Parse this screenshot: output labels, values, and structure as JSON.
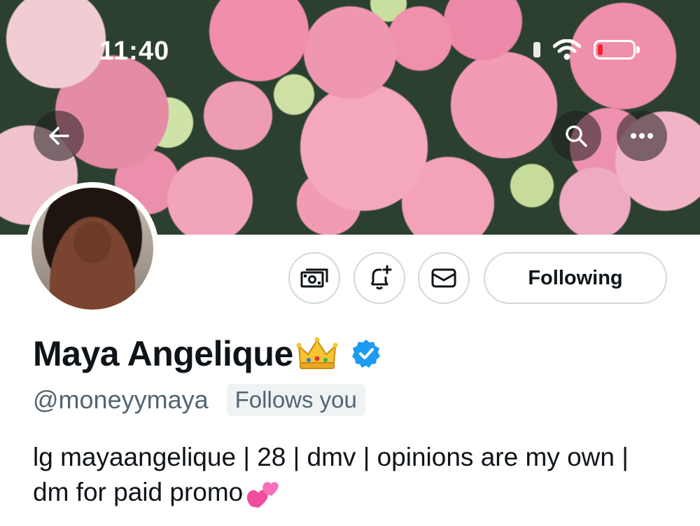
{
  "status_bar": {
    "time": "11:40",
    "battery_level": 0.15
  },
  "header": {
    "back_icon": "arrow-left-icon",
    "search_icon": "search-icon",
    "more_icon": "more-horizontal-icon"
  },
  "profile": {
    "display_name": "Maya Angelique",
    "name_emoji": "crown-emoji",
    "verified_icon": "verified-badge-icon",
    "handle": "@moneyymaya",
    "follows_you": "Follows you",
    "bio": "lg mayaangelique | 28 | dmv | opinions are my own | dm for paid promo",
    "bio_emoji": "two-hearts-emoji"
  },
  "actions": {
    "tip_icon": "money-tip-icon",
    "notify_icon": "bell-plus-icon",
    "message_icon": "envelope-icon",
    "following_label": "Following"
  },
  "colors": {
    "accent": "#1d9bf0",
    "muted": "#536471",
    "border": "#cfd9de",
    "battery_low": "#f4222e"
  }
}
